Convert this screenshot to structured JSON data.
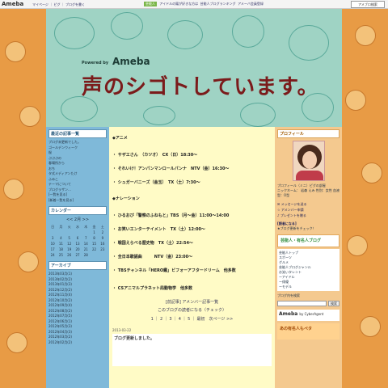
{
  "topbar": {
    "logo": "Ameba",
    "links": "マイページ ｜ ピグ ｜ ブログを書く",
    "green_tag": "芸能人",
    "mid_text": "アイドルの鳳が好きな方は",
    "mid_text_2": "芸能人ブログランキング",
    "mid_text_3": "アメーバ会員登録",
    "search_label": "アメブロ検索"
  },
  "header": {
    "powered_by": "Powered by",
    "brand": "Ameba",
    "title": "声のシゴトしています。"
  },
  "left": {
    "recent_title": "最近の記事一覧",
    "recent_items": [
      "ブログ未更新でした。",
      "ゴールデンウィーク",
      "桜",
      "ぷぷぷの",
      "春場所から",
      "おち",
      "タ式メディアンたけ",
      "ふみこ",
      "テーマについて",
      "ブログラザン…",
      "[一覧を見る]",
      "[新着一覧を見る]"
    ],
    "calendar_title": "カレンダー",
    "calendar_month": "<< 2月 >>",
    "calendar_rows": [
      [
        "日",
        "月",
        "火",
        "水",
        "木",
        "金",
        "土"
      ],
      [
        "",
        "",
        "",
        "",
        "",
        "1",
        "2"
      ],
      [
        "3",
        "4",
        "5",
        "6",
        "7",
        "8",
        "9"
      ],
      [
        "10",
        "11",
        "12",
        "13",
        "14",
        "15",
        "16"
      ],
      [
        "17",
        "18",
        "19",
        "20",
        "21",
        "22",
        "23"
      ],
      [
        "24",
        "25",
        "26",
        "27",
        "28",
        "",
        ""
      ]
    ],
    "archive_title": "アーカイブ",
    "archive_items": [
      "2013年03月(1)",
      "2013年02月(2)",
      "2013年01月(3)",
      "2012年12月(2)",
      "2012年11月(4)",
      "2012年10月(2)",
      "2012年09月(4)",
      "2012年08月(2)",
      "2012年07月(5)",
      "2012年06月(1)",
      "2012年05月(3)",
      "2012年04月(3)",
      "2012年03月(2)",
      "2012年02月(2)"
    ]
  },
  "main": {
    "anime_heading": "◆アニメ",
    "anime_items": [
      "・ サザエさん　（カツオ）　CX（日）18:30〜",
      "・ それいけ！アンパンマンロールパンナ　NTV（金）16:30〜",
      "・ シュガーバニーズ（金玉）　TX（土）7:30〜"
    ],
    "narration_heading": "◆ナレーション",
    "narration_items": [
      "・ ひるおび「警察のふねもと」TBS（月〜金）11:00〜14:00",
      "・ お笑いエンターテイメント　TX（土）12:00〜",
      "・ 戦国えらべる歴史物　TX（土）22:54〜",
      "・ 全日本歌謡曲　　　NTV（金）23:00〜",
      "・ TBSチャンネル「HERO鑑」ビフォーアフタードリーム　他多数"
    ],
    "cm_item": "・ CSアニマルプラネット局動物学　他多数",
    "nav_link": "[前記事] アメンバー記事一覧",
    "rank_link": "このブログの読者になる（チェック）",
    "pager": "1 ｜ 2 ｜ 3 ｜ 4 ｜ 5 ｜ 最初　次ページ >>",
    "entry_date": "2013-03-22",
    "entry_title": "ブログ更新しました。"
  },
  "right": {
    "profile_title": "プロフィール",
    "profile_caption": "プロフィール（ミニ）ピグの部屋",
    "profile_meta": "ニックネーム：",
    "profile_meta_2": "岩森 えみ",
    "profile_meta_3": "性別：女性",
    "profile_meta_4": "血液型：O型",
    "buttons": [
      "メッセージを送る",
      "アメンバー申請",
      "プレゼントを贈る"
    ],
    "reader_label": "[読者になる]",
    "reader_note": "★ブログ更新をチェック！",
    "banner": "芸能人・有名人ブログ",
    "green_list": [
      "芸能人トップ",
      "スポーツ",
      "グルメ",
      "芸能人ブログジャンル",
      "お笑いタレント",
      "ーアイドル",
      "ー俳優",
      "ーモデル"
    ],
    "search_label": "ブログ内を検索",
    "search_btn": "検索",
    "ameba_logo": "Ameba",
    "ameba_by": "by CyberAgent",
    "pet_banner": "あの有名人もペタ"
  }
}
